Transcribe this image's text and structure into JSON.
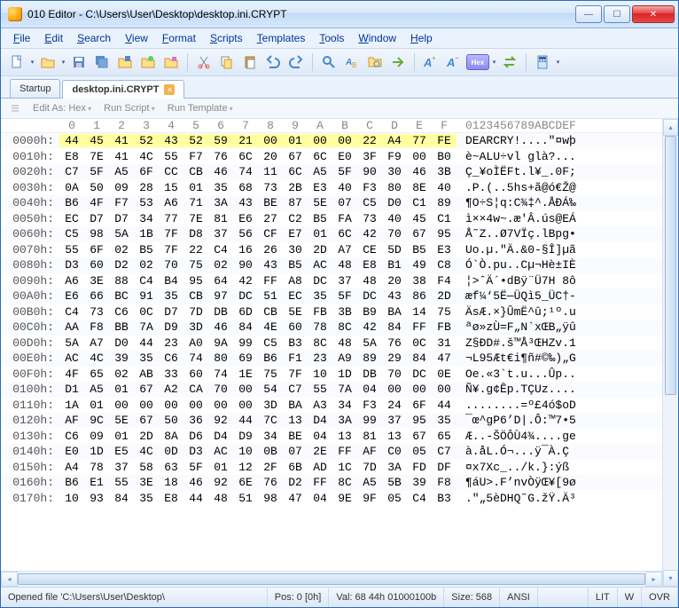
{
  "titlebar": {
    "app": "010 Editor",
    "path": "C:\\Users\\User\\Desktop\\desktop.ini.CRYPT"
  },
  "menus": [
    "File",
    "Edit",
    "Search",
    "View",
    "Format",
    "Scripts",
    "Templates",
    "Tools",
    "Window",
    "Help"
  ],
  "tabs": [
    {
      "label": "Startup",
      "active": false,
      "closable": false
    },
    {
      "label": "desktop.ini.CRYPT",
      "active": true,
      "closable": true
    }
  ],
  "subbar": {
    "edit_as": "Edit As: Hex",
    "run_script": "Run Script",
    "run_template": "Run Template"
  },
  "hex_header": [
    "0",
    "1",
    "2",
    "3",
    "4",
    "5",
    "6",
    "7",
    "8",
    "9",
    "A",
    "B",
    "C",
    "D",
    "E",
    "F"
  ],
  "asc_header": "0123456789ABCDEF",
  "rows": [
    {
      "addr": "0000h:",
      "hl": true,
      "hex": [
        "44",
        "45",
        "41",
        "52",
        "43",
        "52",
        "59",
        "21",
        "00",
        "01",
        "00",
        "00",
        "22",
        "A4",
        "77",
        "FE"
      ],
      "asc": "DEARCRY!....\"¤wþ"
    },
    {
      "addr": "0010h:",
      "hex": [
        "E8",
        "7E",
        "41",
        "4C",
        "55",
        "F7",
        "76",
        "6C",
        "20",
        "67",
        "6C",
        "E0",
        "3F",
        "F9",
        "00",
        "B0"
      ],
      "asc": "è~ALU÷vl glà?..."
    },
    {
      "addr": "0020h:",
      "hex": [
        "C7",
        "5F",
        "A5",
        "6F",
        "CC",
        "CB",
        "46",
        "74",
        "11",
        "6C",
        "A5",
        "5F",
        "90",
        "30",
        "46",
        "3B"
      ],
      "asc": "Ç_¥oÌËFt.l¥_.0F;"
    },
    {
      "addr": "0030h:",
      "hex": [
        "0A",
        "50",
        "09",
        "28",
        "15",
        "01",
        "35",
        "68",
        "73",
        "2B",
        "E3",
        "40",
        "F3",
        "80",
        "8E",
        "40"
      ],
      "asc": ".P.(..5hs+ã@ó€Ž@"
    },
    {
      "addr": "0040h:",
      "hex": [
        "B6",
        "4F",
        "F7",
        "53",
        "A6",
        "71",
        "3A",
        "43",
        "BE",
        "87",
        "5E",
        "07",
        "C5",
        "D0",
        "C1",
        "89"
      ],
      "asc": "¶O÷S¦q:C¾‡^.ÅÐÁ‰"
    },
    {
      "addr": "0050h:",
      "hex": [
        "EC",
        "D7",
        "D7",
        "34",
        "77",
        "7E",
        "81",
        "E6",
        "27",
        "C2",
        "B5",
        "FA",
        "73",
        "40",
        "45",
        "C1"
      ],
      "asc": "ì××4w~.æ'Â.ús@EÁ"
    },
    {
      "addr": "0060h:",
      "hex": [
        "C5",
        "98",
        "5A",
        "1B",
        "7F",
        "D8",
        "37",
        "56",
        "CF",
        "E7",
        "01",
        "6C",
        "42",
        "70",
        "67",
        "95"
      ],
      "asc": "Å˜Z..Ø7VÏç.lBpg•"
    },
    {
      "addr": "0070h:",
      "hex": [
        "55",
        "6F",
        "02",
        "B5",
        "7F",
        "22",
        "C4",
        "16",
        "26",
        "30",
        "2D",
        "A7",
        "CE",
        "5D",
        "B5",
        "E3"
      ],
      "asc": "Uo.µ.\"Ä.&0-§Î]µã"
    },
    {
      "addr": "0080h:",
      "hex": [
        "D3",
        "60",
        "D2",
        "02",
        "70",
        "75",
        "02",
        "90",
        "43",
        "B5",
        "AC",
        "48",
        "E8",
        "B1",
        "49",
        "C8"
      ],
      "asc": "Ó`Ò.pu..Cµ¬Hè±IÈ"
    },
    {
      "addr": "0090h:",
      "hex": [
        "A6",
        "3E",
        "88",
        "C4",
        "B4",
        "95",
        "64",
        "42",
        "FF",
        "A8",
        "DC",
        "37",
        "48",
        "20",
        "38",
        "F4"
      ],
      "asc": "¦>ˆÄ´•dBÿ¨Ü7H 8ô"
    },
    {
      "addr": "00A0h:",
      "hex": [
        "E6",
        "66",
        "BC",
        "91",
        "35",
        "CB",
        "97",
        "DC",
        "51",
        "EC",
        "35",
        "5F",
        "DC",
        "43",
        "86",
        "2D"
      ],
      "asc": "æf¼‘5Ë—ÜQì5_ÜC†-"
    },
    {
      "addr": "00B0h:",
      "hex": [
        "C4",
        "73",
        "C6",
        "0C",
        "D7",
        "7D",
        "DB",
        "6D",
        "CB",
        "5E",
        "FB",
        "3B",
        "B9",
        "BA",
        "14",
        "75"
      ],
      "asc": "ÄsÆ.×}ÛmË^û;¹º.u"
    },
    {
      "addr": "00C0h:",
      "hex": [
        "AA",
        "F8",
        "BB",
        "7A",
        "D9",
        "3D",
        "46",
        "84",
        "4E",
        "60",
        "78",
        "8C",
        "42",
        "84",
        "FF",
        "FB"
      ],
      "asc": "ªø»zÙ=F„N`xŒB„ÿû"
    },
    {
      "addr": "00D0h:",
      "hex": [
        "5A",
        "A7",
        "D0",
        "44",
        "23",
        "A0",
        "9A",
        "99",
        "C5",
        "B3",
        "8C",
        "48",
        "5A",
        "76",
        "0C",
        "31"
      ],
      "asc": "Z§ÐD#.š™Å³ŒHZv.1"
    },
    {
      "addr": "00E0h:",
      "hex": [
        "AC",
        "4C",
        "39",
        "35",
        "C6",
        "74",
        "80",
        "69",
        "B6",
        "F1",
        "23",
        "A9",
        "89",
        "29",
        "84",
        "47"
      ],
      "asc": "¬L95Æt€i¶ñ#©‰)„G"
    },
    {
      "addr": "00F0h:",
      "hex": [
        "4F",
        "65",
        "02",
        "AB",
        "33",
        "60",
        "74",
        "1E",
        "75",
        "7F",
        "10",
        "1D",
        "DB",
        "70",
        "DC",
        "0E"
      ],
      "asc": "Oe.«3`t.u...Ûp.."
    },
    {
      "addr": "0100h:",
      "hex": [
        "D1",
        "A5",
        "01",
        "67",
        "A2",
        "CA",
        "70",
        "00",
        "54",
        "C7",
        "55",
        "7A",
        "04",
        "00",
        "00",
        "00"
      ],
      "asc": "Ñ¥.g¢Êp.TÇUz...."
    },
    {
      "addr": "0110h:",
      "hex": [
        "1A",
        "01",
        "00",
        "00",
        "00",
        "00",
        "00",
        "00",
        "3D",
        "BA",
        "A3",
        "34",
        "F3",
        "24",
        "6F",
        "44"
      ],
      "asc": "........=º£4ó$oD"
    },
    {
      "addr": "0120h:",
      "hex": [
        "AF",
        "9C",
        "5E",
        "67",
        "50",
        "36",
        "92",
        "44",
        "7C",
        "13",
        "D4",
        "3A",
        "99",
        "37",
        "95",
        "35"
      ],
      "asc": "¯œ^gP6’D|.Ô:™7•5"
    },
    {
      "addr": "0130h:",
      "hex": [
        "C6",
        "09",
        "01",
        "2D",
        "8A",
        "D6",
        "D4",
        "D9",
        "34",
        "BE",
        "04",
        "13",
        "81",
        "13",
        "67",
        "65"
      ],
      "asc": "Æ..-ŠÖÔÙ4¾....ge"
    },
    {
      "addr": "0140h:",
      "hex": [
        "E0",
        "1D",
        "E5",
        "4C",
        "0D",
        "D3",
        "AC",
        "10",
        "0B",
        "07",
        "2E",
        "FF",
        "AF",
        "C0",
        "05",
        "C7"
      ],
      "asc": "à.åL.Ó¬...ÿ¯À.Ç"
    },
    {
      "addr": "0150h:",
      "hex": [
        "A4",
        "78",
        "37",
        "58",
        "63",
        "5F",
        "01",
        "12",
        "2F",
        "6B",
        "AD",
        "1C",
        "7D",
        "3A",
        "FD",
        "DF"
      ],
      "asc": "¤x7Xc_../k­.}:ýß"
    },
    {
      "addr": "0160h:",
      "hex": [
        "B6",
        "E1",
        "55",
        "3E",
        "18",
        "46",
        "92",
        "6E",
        "76",
        "D2",
        "FF",
        "8C",
        "A5",
        "5B",
        "39",
        "F8"
      ],
      "asc": "¶áU>.F’nvÒÿŒ¥[9ø"
    },
    {
      "addr": "0170h:",
      "hex": [
        "10",
        "93",
        "84",
        "35",
        "E8",
        "44",
        "48",
        "51",
        "98",
        "47",
        "04",
        "9E",
        "9F",
        "05",
        "C4",
        "B3"
      ],
      "asc": ".\"„5èDHQ˜G.žŸ.Ä³"
    }
  ],
  "status": {
    "opened": "Opened file 'C:\\Users\\User\\Desktop\\",
    "pos": "Pos: 0 [0h]",
    "val": "Val: 68 44h 01000100b",
    "size": "Size: 568",
    "enc": "ANSI",
    "lit": "LIT",
    "w": "W",
    "ovr": "OVR"
  }
}
